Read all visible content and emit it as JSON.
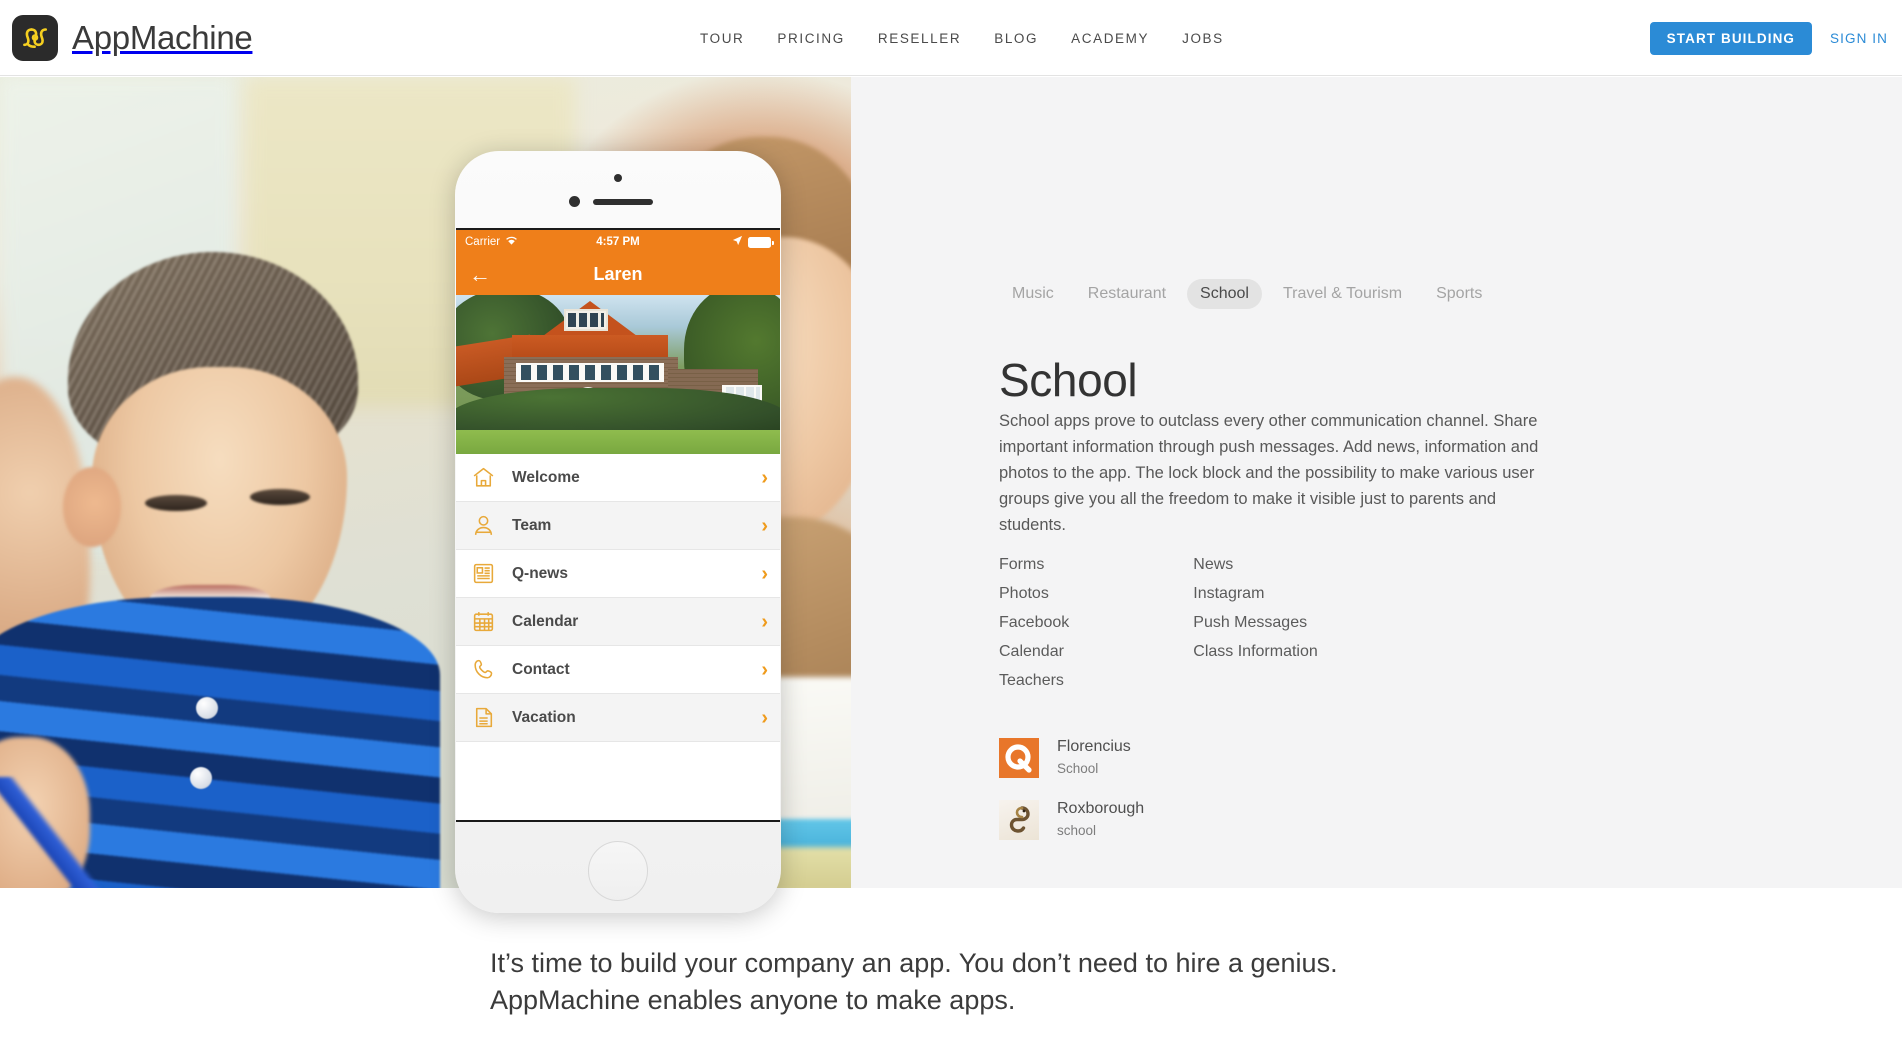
{
  "header": {
    "brand_name": "AppMachine",
    "logo_icon": "appmachine-knot-logo",
    "nav": [
      {
        "label": "TOUR"
      },
      {
        "label": "PRICING"
      },
      {
        "label": "RESELLER"
      },
      {
        "label": "BLOG"
      },
      {
        "label": "ACADEMY"
      },
      {
        "label": "JOBS"
      }
    ],
    "start_building_label": "START BUILDING",
    "sign_in_label": "SIGN IN",
    "accent_color": "#2b8bd6"
  },
  "phone": {
    "status": {
      "carrier": "Carrier",
      "wifi_icon": "wifi-icon",
      "time": "4:57 PM",
      "location_icon": "location-arrow-icon",
      "battery_icon": "battery-full-icon"
    },
    "navbar": {
      "back_icon": "arrow-left-icon",
      "title": "Laren"
    },
    "hero_photo_alt": "school-building-photo",
    "menu": [
      {
        "label": "Welcome",
        "icon": "home-icon",
        "chevron": "chevron-right-icon"
      },
      {
        "label": "Team",
        "icon": "person-icon",
        "chevron": "chevron-right-icon"
      },
      {
        "label": "Q-news",
        "icon": "newspaper-icon",
        "chevron": "chevron-right-icon"
      },
      {
        "label": "Calendar",
        "icon": "calendar-icon",
        "chevron": "chevron-right-icon"
      },
      {
        "label": "Contact",
        "icon": "phone-icon",
        "chevron": "chevron-right-icon"
      },
      {
        "label": "Vacation",
        "icon": "document-icon",
        "chevron": "chevron-right-icon"
      }
    ],
    "accent_color": "#ef7f1a"
  },
  "panel": {
    "tabs": [
      {
        "label": "Music",
        "active": false
      },
      {
        "label": "Restaurant",
        "active": false
      },
      {
        "label": "School",
        "active": true
      },
      {
        "label": "Travel & Tourism",
        "active": false
      },
      {
        "label": "Sports",
        "active": false
      }
    ],
    "title": "School",
    "description": "School apps prove to outclass every other communication channel. Share important information through push messages. Add news, information and photos to the app. The lock block and the possibility to make various user groups give you all the freedom to make it visible just to parents and students.",
    "features_col1": [
      "Forms",
      "Photos",
      "Facebook",
      "Calendar",
      "Teachers"
    ],
    "features_col2": [
      "News",
      "Instagram",
      "Push Messages",
      "Class Information"
    ],
    "apps": [
      {
        "name": "Florencius",
        "category": "School",
        "icon": "florencius-q-icon",
        "icon_color": "#e8762a"
      },
      {
        "name": "Roxborough",
        "category": "school",
        "icon": "roxborough-snake-icon",
        "icon_color": "#8a6a3c"
      }
    ]
  },
  "tagline": {
    "line1": "It’s time to build your company an app. You don’t need to hire a genius.",
    "line2": "AppMachine enables anyone to make apps."
  }
}
